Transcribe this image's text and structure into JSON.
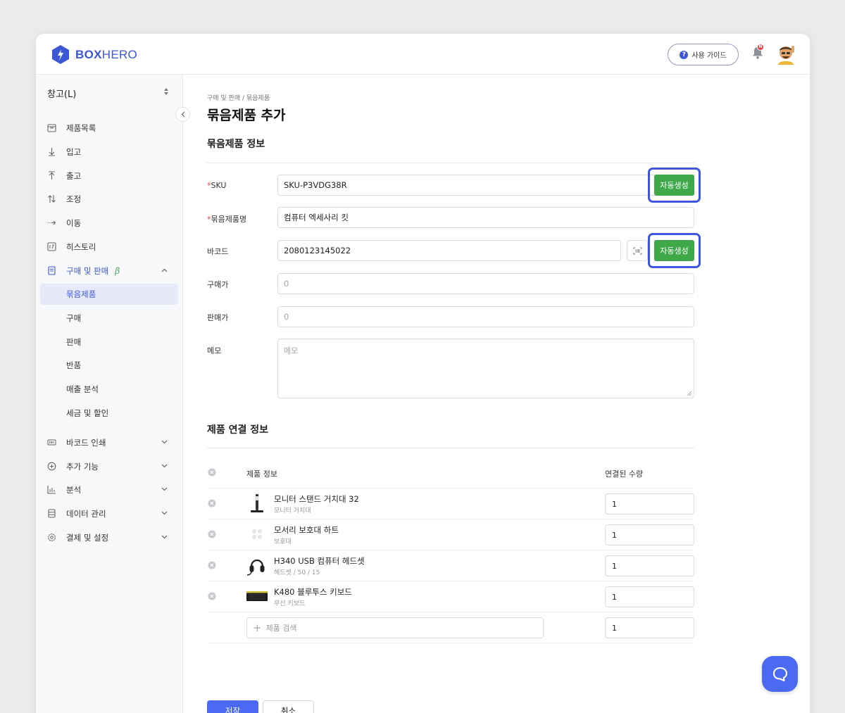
{
  "brand": {
    "name_bold": "BOX",
    "name_light": "HERO"
  },
  "header": {
    "guide_label": "사용 가이드",
    "guide_icon": "question-circle-icon",
    "notification_badge": "N"
  },
  "sidebar": {
    "warehouse": "창고(L)",
    "items": [
      {
        "label": "제품목록",
        "icon": "box-icon"
      },
      {
        "label": "입고",
        "icon": "arrow-down-icon"
      },
      {
        "label": "출고",
        "icon": "arrow-up-icon"
      },
      {
        "label": "조정",
        "icon": "swap-vertical-icon"
      },
      {
        "label": "이동",
        "icon": "move-arrow-icon"
      },
      {
        "label": "히스토리",
        "icon": "history-icon"
      },
      {
        "label": "구매 및 판매",
        "icon": "document-icon",
        "beta": "β"
      },
      {
        "label": "묶음제품"
      },
      {
        "label": "구매"
      },
      {
        "label": "판매"
      },
      {
        "label": "반품"
      },
      {
        "label": "매출 분석"
      },
      {
        "label": "세금 및 할인"
      },
      {
        "label": "바코드 인쇄",
        "icon": "barcode-icon"
      },
      {
        "label": "추가 기능",
        "icon": "plus-circle-icon"
      },
      {
        "label": "분석",
        "icon": "bar-chart-icon"
      },
      {
        "label": "데이터 관리",
        "icon": "database-icon"
      },
      {
        "label": "결제 및 설정",
        "icon": "gear-icon"
      }
    ]
  },
  "page": {
    "breadcrumb": "구매 및 판매 / 묶음제품",
    "title": "묶음제품 추가",
    "info_section_title": "묶음제품 정보",
    "link_section_title": "제품 연결 정보"
  },
  "form": {
    "sku": {
      "required": "*",
      "label": "SKU",
      "value": "SKU-P3VDG38R",
      "auto_label": "자동생성"
    },
    "name": {
      "required": "*",
      "label": "묶음제품명",
      "value": "컴퓨터 엑세사리 킷"
    },
    "barcode": {
      "label": "바코드",
      "value": "2080123145022",
      "auto_label": "자동생성"
    },
    "purchase_price": {
      "label": "구매가",
      "placeholder": "0"
    },
    "sale_price": {
      "label": "판매가",
      "placeholder": "0"
    },
    "memo": {
      "label": "메모",
      "placeholder": "메모"
    }
  },
  "table": {
    "col_product": "제품 정보",
    "col_qty": "연결된 수량",
    "rows": [
      {
        "name": "모니터 스탠드 거치대 32",
        "sub": "모니터 거치대",
        "qty": "1"
      },
      {
        "name": "모서리 보호대 하트",
        "sub": "보호대",
        "qty": "1"
      },
      {
        "name": "H340 USB 컴퓨터 헤드셋",
        "sub": "헤드셋 / 50 / 15",
        "qty": "1"
      },
      {
        "name": "K480 블루투스 키보드",
        "sub": "무선 키보드",
        "qty": "1"
      }
    ],
    "search_placeholder": "제품 검색",
    "search_qty": "1"
  },
  "actions": {
    "save": "저장",
    "cancel": "취소"
  },
  "colors": {
    "primary": "#4b6af1",
    "auto_green": "#3fa94a",
    "highlight_border": "#3e55e0",
    "beta_green": "#3fa85c"
  }
}
